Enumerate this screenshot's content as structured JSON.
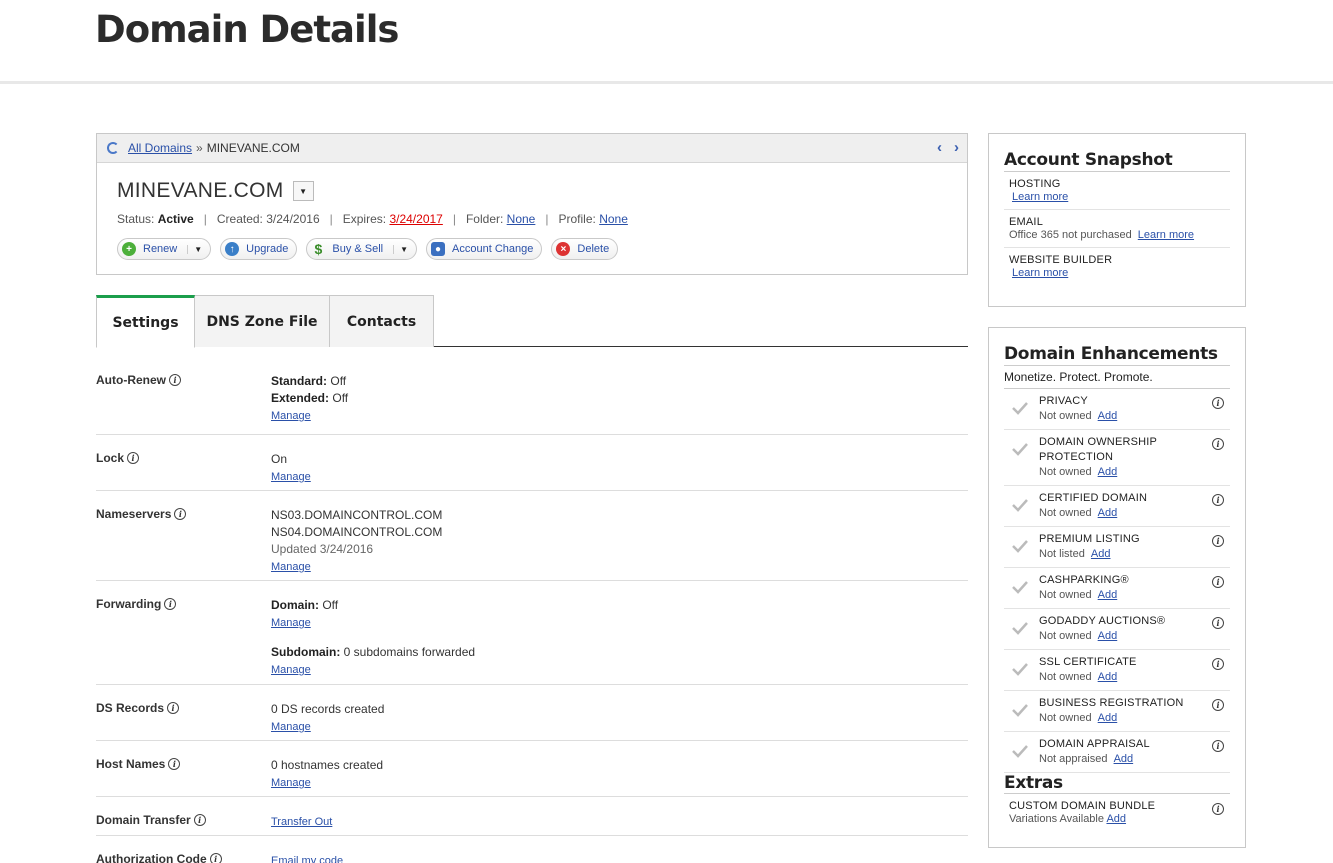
{
  "page": {
    "title": "Domain Details"
  },
  "breadcrumb": {
    "all_domains": "All Domains",
    "sep": "»",
    "current": "MINEVANE.COM",
    "prev": "‹",
    "next": "›"
  },
  "domain": {
    "name": "MINEVANE.COM",
    "status_label": "Status:",
    "status": "Active",
    "created_label": "Created:",
    "created": "3/24/2016",
    "expires_label": "Expires:",
    "expires": "3/24/2017",
    "folder_label": "Folder:",
    "folder": "None",
    "profile_label": "Profile:",
    "profile": "None"
  },
  "actions": [
    {
      "label": "Renew",
      "icon": "plus-icon",
      "color": "#4caf3a",
      "caret": true
    },
    {
      "label": "Upgrade",
      "icon": "up-arrow-icon",
      "color": "#3a7fc8",
      "caret": false
    },
    {
      "label": "Buy & Sell",
      "icon": "dollar-icon",
      "color": "#3a8d2a",
      "caret": true
    },
    {
      "label": "Account Change",
      "icon": "user-icon",
      "color": "#3a6fc0",
      "caret": false
    },
    {
      "label": "Delete",
      "icon": "close-icon",
      "color": "#d33",
      "caret": false
    }
  ],
  "tabs": [
    {
      "label": "Settings",
      "active": true
    },
    {
      "label": "DNS Zone File",
      "active": false
    },
    {
      "label": "Contacts",
      "active": false
    }
  ],
  "settings": {
    "auto_renew": {
      "label": "Auto-Renew",
      "standard_label": "Standard:",
      "standard": "Off",
      "extended_label": "Extended:",
      "extended": "Off",
      "manage": "Manage"
    },
    "lock": {
      "label": "Lock",
      "value": "On",
      "manage": "Manage"
    },
    "nameservers": {
      "label": "Nameservers",
      "ns1": "NS03.DOMAINCONTROL.COM",
      "ns2": "NS04.DOMAINCONTROL.COM",
      "updated": "Updated 3/24/2016",
      "manage": "Manage"
    },
    "forwarding": {
      "label": "Forwarding",
      "domain_label": "Domain:",
      "domain": "Off",
      "manage1": "Manage",
      "subdomain_label": "Subdomain:",
      "subdomain": "0 subdomains forwarded",
      "manage2": "Manage"
    },
    "ds_records": {
      "label": "DS Records",
      "value": "0 DS records created",
      "manage": "Manage"
    },
    "host_names": {
      "label": "Host Names",
      "value": "0 hostnames created",
      "manage": "Manage"
    },
    "domain_transfer": {
      "label": "Domain Transfer",
      "link": "Transfer Out"
    },
    "auth_code": {
      "label": "Authorization Code",
      "link": "Email my code"
    }
  },
  "snapshot": {
    "title": "Account Snapshot",
    "items": [
      {
        "heading": "HOSTING",
        "text": "",
        "link": "Learn more"
      },
      {
        "heading": "EMAIL",
        "text": "Office 365 not purchased",
        "link": "Learn more"
      },
      {
        "heading": "WEBSITE BUILDER",
        "text": "",
        "link": "Learn more"
      }
    ]
  },
  "enhancements": {
    "title": "Domain Enhancements",
    "tagline": "Monetize. Protect. Promote.",
    "items": [
      {
        "heading": "PRIVACY",
        "status": "Not owned",
        "link": "Add"
      },
      {
        "heading": "DOMAIN OWNERSHIP PROTECTION",
        "status": "Not owned",
        "link": "Add"
      },
      {
        "heading": "CERTIFIED DOMAIN",
        "status": "Not owned",
        "link": "Add"
      },
      {
        "heading": "PREMIUM LISTING",
        "status": "Not listed",
        "link": "Add"
      },
      {
        "heading": "CASHPARKING®",
        "status": "Not owned",
        "link": "Add"
      },
      {
        "heading": "GODADDY AUCTIONS®",
        "status": "Not owned",
        "link": "Add"
      },
      {
        "heading": "SSL CERTIFICATE",
        "status": "Not owned",
        "link": "Add"
      },
      {
        "heading": "BUSINESS REGISTRATION",
        "status": "Not owned",
        "link": "Add"
      },
      {
        "heading": "DOMAIN APPRAISAL",
        "status": "Not appraised",
        "link": "Add"
      }
    ],
    "extras_title": "Extras",
    "extras": [
      {
        "heading": "CUSTOM DOMAIN BUNDLE",
        "status": "Variations Available",
        "link": "Add"
      }
    ]
  }
}
